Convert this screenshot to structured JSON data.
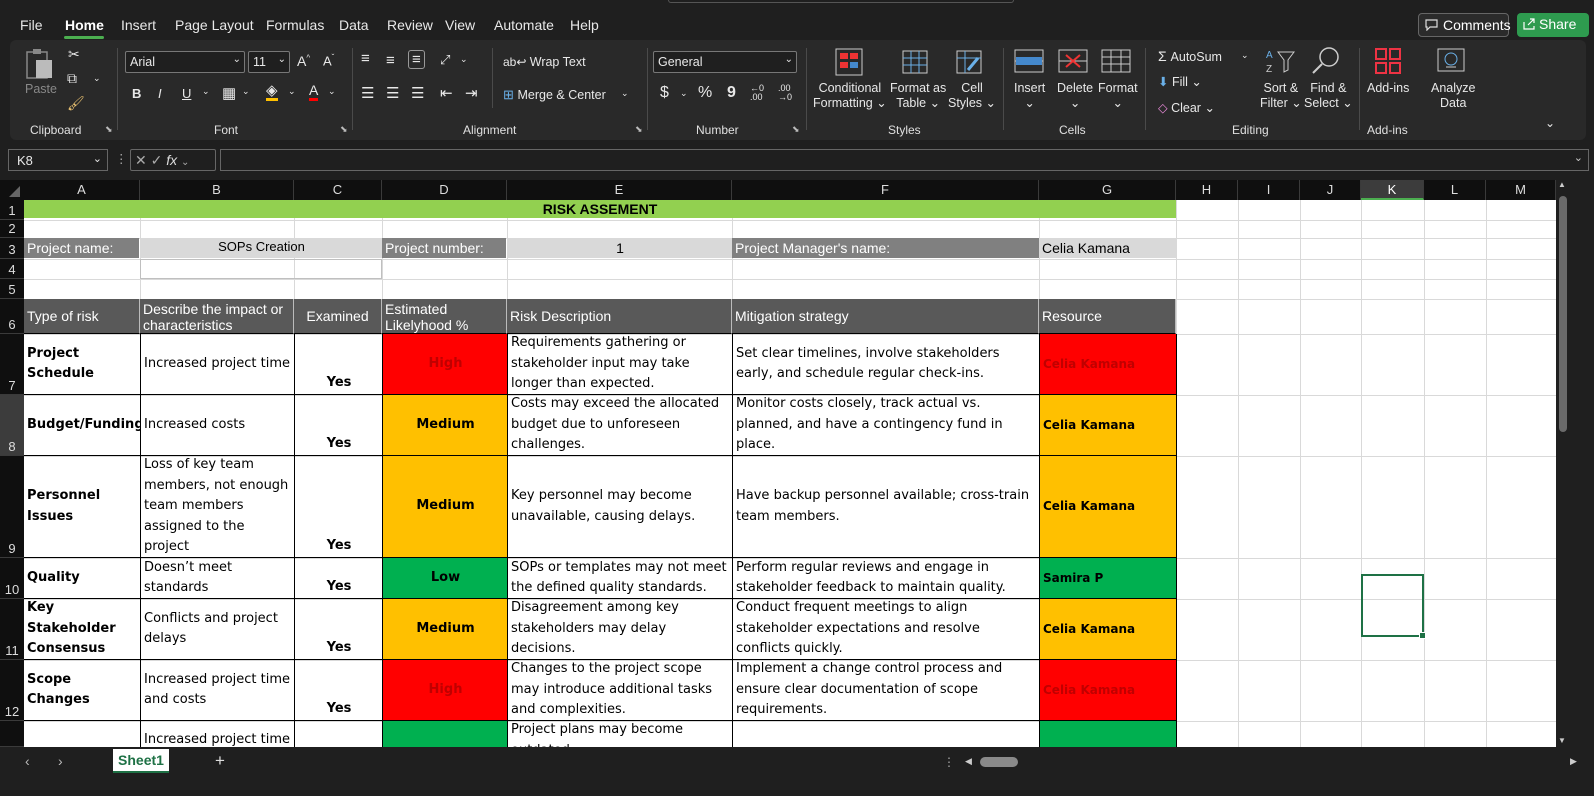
{
  "menu": {
    "tabs": [
      "File",
      "Home",
      "Insert",
      "Page Layout",
      "Formulas",
      "Data",
      "Review",
      "View",
      "Automate",
      "Help"
    ],
    "comments": "Comments",
    "share": "Share"
  },
  "ribbon": {
    "paste": "Paste",
    "font_name": "Arial",
    "font_size": "11",
    "wrap_text": "Wrap Text",
    "merge_center": "Merge & Center",
    "number_format": "General",
    "cond_format": [
      "Conditional",
      "Formatting"
    ],
    "format_table": [
      "Format as",
      "Table"
    ],
    "cell_styles": [
      "Cell",
      "Styles"
    ],
    "insert": "Insert",
    "delete": "Delete",
    "format": "Format",
    "autosum": "AutoSum",
    "fill": "Fill",
    "clear": "Clear",
    "sort_filter": [
      "Sort &",
      "Filter"
    ],
    "find_select": [
      "Find &",
      "Select"
    ],
    "addins": "Add-ins",
    "analyze": [
      "Analyze",
      "Data"
    ],
    "groups": {
      "clipboard": "Clipboard",
      "font": "Font",
      "alignment": "Alignment",
      "number": "Number",
      "styles": "Styles",
      "cells": "Cells",
      "editing": "Editing",
      "addins": "Add-ins"
    }
  },
  "formula_bar": {
    "name_box": "K8",
    "fx": "fx",
    "value": ""
  },
  "columns": [
    "A",
    "B",
    "C",
    "D",
    "E",
    "F",
    "G",
    "H",
    "I",
    "J",
    "K",
    "L",
    "M"
  ],
  "rows": [
    "1",
    "2",
    "3",
    "4",
    "5",
    "6",
    "7",
    "8",
    "9",
    "10",
    "11",
    "12"
  ],
  "sheet": {
    "title": "RISK ASSEMENT",
    "project_name_label": "Project name:",
    "project_name": "SOPs Creation",
    "project_number_label": "Project number:",
    "project_number": "1",
    "manager_label": "Project Manager's name:",
    "manager": "Celia Kamana",
    "headers": [
      "Type of risk",
      "Describe the impact or characteristics",
      "Examined",
      "Estimated Likelyhood %",
      "Risk Description",
      "Mitigation strategy",
      "Resource"
    ],
    "risks": [
      {
        "type": "Project Schedule",
        "impact": "Increased project time",
        "examined": "Yes",
        "likelihood": "High",
        "level": "red",
        "description": "Requirements gathering or stakeholder input may take longer than expected.",
        "mitigation": "Set clear timelines, involve stakeholders early, and schedule regular check-ins.",
        "resource": "Celia Kamana"
      },
      {
        "type": "Budget/Funding",
        "impact": "Increased costs",
        "examined": "Yes",
        "likelihood": "Medium",
        "level": "amber",
        "description": "Costs may exceed the allocated budget due to unforeseen challenges.",
        "mitigation": "Monitor costs closely, track actual vs. planned, and have a contingency fund in place.",
        "resource": "Celia Kamana"
      },
      {
        "type": "Personnel Issues",
        "impact": "Loss of key team members, not enough team members assigned to the project",
        "examined": "Yes",
        "likelihood": "Medium",
        "level": "amber",
        "description": "Key personnel may become unavailable, causing delays.",
        "mitigation": "Have backup personnel available; cross-train team members.",
        "resource": "Celia Kamana"
      },
      {
        "type": "Quality",
        "impact": "Doesn’t meet standards",
        "examined": "Yes",
        "likelihood": "Low",
        "level": "green",
        "description": "SOPs or templates may not meet the defined quality standards.",
        "mitigation": "Perform regular reviews and engage in stakeholder feedback to maintain quality.",
        "resource": "Samira P"
      },
      {
        "type": "Key Stakeholder Consensus",
        "impact": "Conflicts and project delays",
        "examined": "Yes",
        "likelihood": "Medium",
        "level": "amber",
        "description": "Disagreement among key stakeholders may delay decisions.",
        "mitigation": "Conduct frequent meetings to align stakeholder expectations and resolve conflicts quickly.",
        "resource": " Celia Kamana"
      },
      {
        "type": "Scope Changes",
        "impact": "Increased project time and costs",
        "examined": "Yes",
        "likelihood": "High",
        "level": "red",
        "description": "Changes to the project scope may introduce additional tasks and complexities.",
        "mitigation": "Implement a change control process and ensure clear documentation of scope requirements.",
        "resource": "Celia Kamana"
      },
      {
        "type": "",
        "impact": "Increased project time",
        "examined": "",
        "likelihood": "",
        "level": "green",
        "description": "Project plans may become outdated",
        "mitigation": "",
        "resource": ""
      }
    ]
  },
  "sheet_tabs": [
    "Sheet1"
  ],
  "colors": {
    "red": "#ff0000",
    "amber": "#ffc000",
    "green": "#00b050",
    "title_bg": "#92d050",
    "header_bg": "#595959",
    "accent": "#1e7145"
  }
}
